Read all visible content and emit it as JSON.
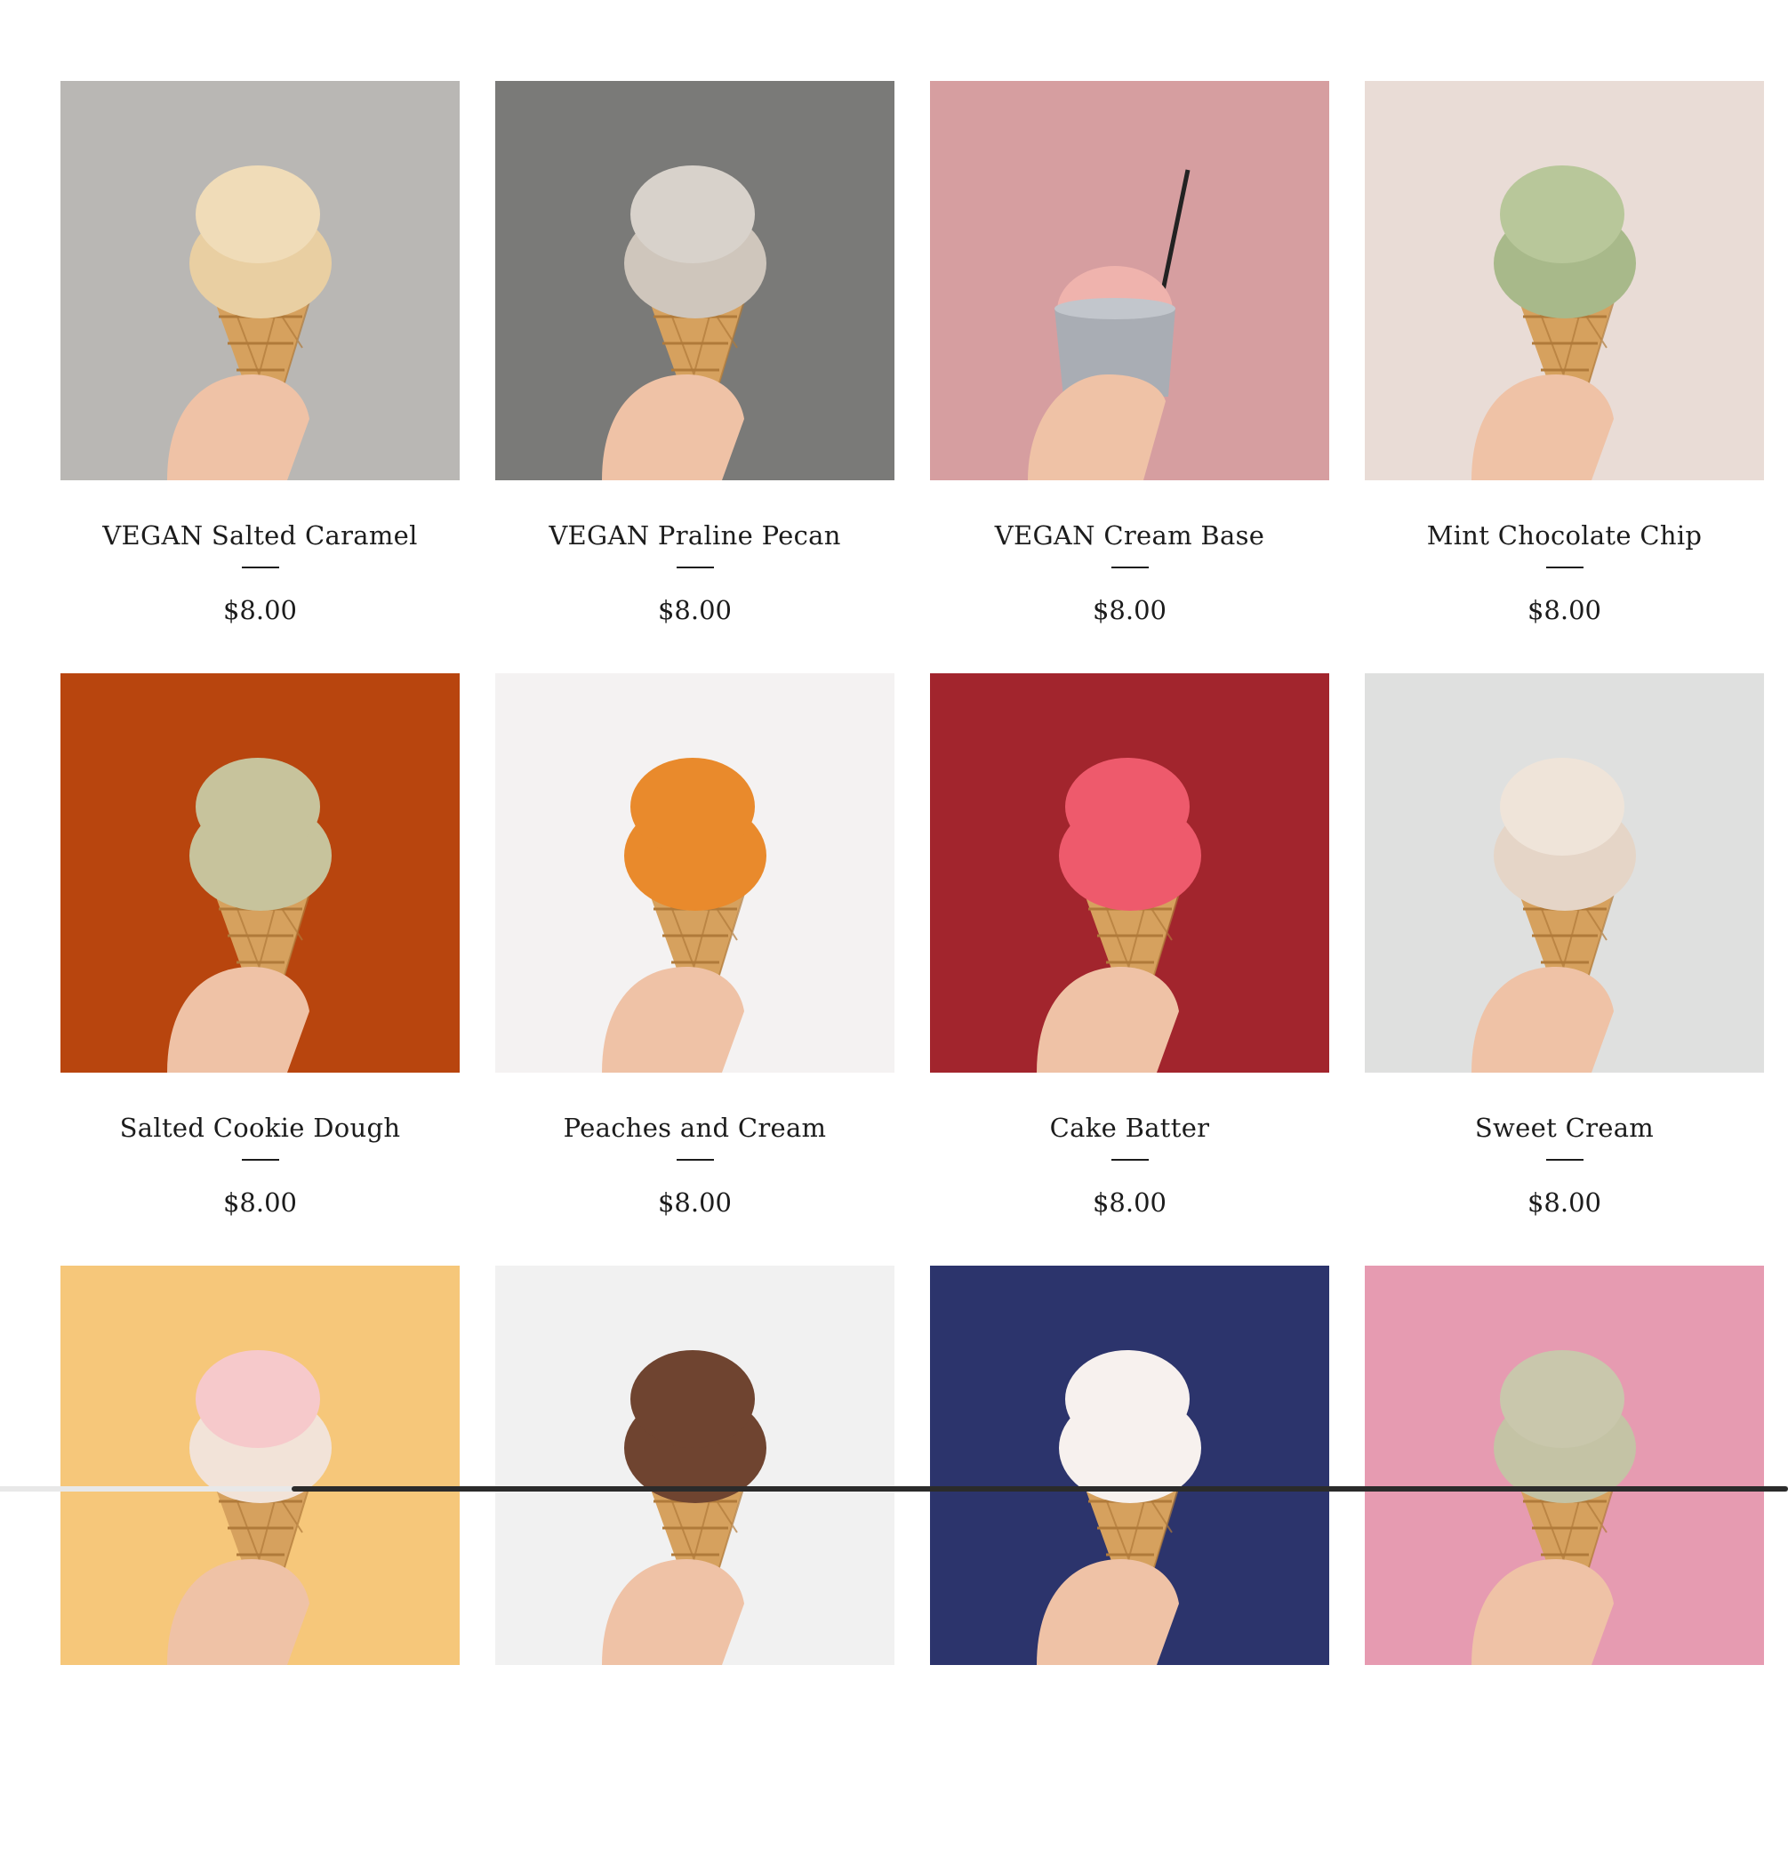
{
  "products": [
    {
      "name": "VEGAN Salted Caramel",
      "price": "$8.00",
      "bg": "#b9b7b4",
      "scoop": "#f0dcb8",
      "scoop2": "#e9cfa2",
      "icon": "ice-cream-cone-icon"
    },
    {
      "name": "VEGAN Praline Pecan",
      "price": "$8.00",
      "bg": "#7a7a78",
      "scoop": "#d8d2cb",
      "scoop2": "#cfc6bc",
      "icon": "ice-cream-cone-icon"
    },
    {
      "name": "VEGAN Cream Base",
      "price": "$8.00",
      "bg": "#d69ea0",
      "scoop": "#efb3ad",
      "scoop2": "#efb3ad",
      "icon": "ice-cream-cup-icon"
    },
    {
      "name": "Mint Chocolate Chip",
      "price": "$8.00",
      "bg": "#e9dcd6",
      "scoop": "#b8c79a",
      "scoop2": "#a8b98a",
      "icon": "ice-cream-cone-icon"
    },
    {
      "name": "Salted Cookie Dough",
      "price": "$8.00",
      "bg": "#b8450e",
      "scoop": "#c7c39c",
      "scoop2": "#c7c39c",
      "icon": "ice-cream-cone-icon"
    },
    {
      "name": "Peaches and Cream",
      "price": "$8.00",
      "bg": "#f4f2f2",
      "scoop": "#e98a2c",
      "scoop2": "#e98a2c",
      "icon": "ice-cream-cone-icon"
    },
    {
      "name": "Cake Batter",
      "price": "$8.00",
      "bg": "#a2252d",
      "scoop": "#ee5a6c",
      "scoop2": "#ee5a6c",
      "icon": "ice-cream-cone-icon"
    },
    {
      "name": "Sweet Cream",
      "price": "$8.00",
      "bg": "#dfe0df",
      "scoop": "#efe4d9",
      "scoop2": "#e5d5c7",
      "icon": "ice-cream-cone-icon"
    },
    {
      "name": "",
      "price": "",
      "bg": "#f6c77a",
      "scoop": "#f6c9cb",
      "scoop2": "#f2e3d8",
      "icon": "ice-cream-cone-icon"
    },
    {
      "name": "",
      "price": "",
      "bg": "#f1f1f1",
      "scoop": "#6f4430",
      "scoop2": "#6f4430",
      "icon": "ice-cream-cone-icon"
    },
    {
      "name": "",
      "price": "",
      "bg": "#2c346c",
      "scoop": "#f7f1ee",
      "scoop2": "#f7f1ee",
      "icon": "ice-cream-cone-icon"
    },
    {
      "name": "",
      "price": "",
      "bg": "#e69bb1",
      "scoop": "#c9c7ac",
      "scoop2": "#c4c3a5",
      "icon": "ice-cream-cone-icon"
    }
  ],
  "colors": {
    "cone": "#d6a15e",
    "cone_line": "#b07a3a",
    "skin": "#efc2a6"
  }
}
